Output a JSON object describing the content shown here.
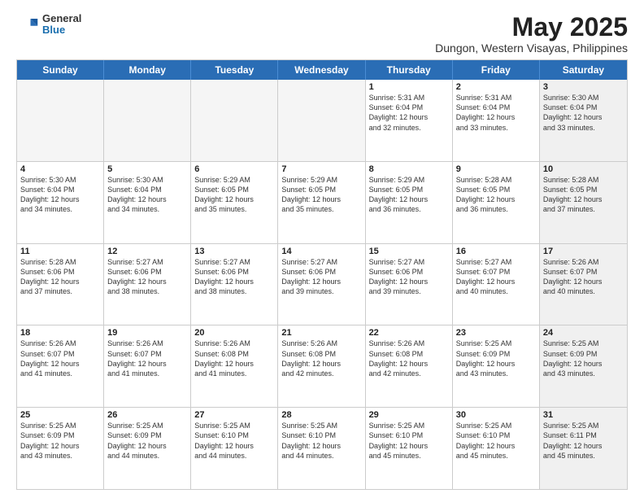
{
  "logo": {
    "general": "General",
    "blue": "Blue"
  },
  "title": "May 2025",
  "subtitle": "Dungon, Western Visayas, Philippines",
  "headers": [
    "Sunday",
    "Monday",
    "Tuesday",
    "Wednesday",
    "Thursday",
    "Friday",
    "Saturday"
  ],
  "rows": [
    [
      {
        "day": "",
        "info": "",
        "empty": true
      },
      {
        "day": "",
        "info": "",
        "empty": true
      },
      {
        "day": "",
        "info": "",
        "empty": true
      },
      {
        "day": "",
        "info": "",
        "empty": true
      },
      {
        "day": "1",
        "info": "Sunrise: 5:31 AM\nSunset: 6:04 PM\nDaylight: 12 hours\nand 32 minutes.",
        "empty": false
      },
      {
        "day": "2",
        "info": "Sunrise: 5:31 AM\nSunset: 6:04 PM\nDaylight: 12 hours\nand 33 minutes.",
        "empty": false
      },
      {
        "day": "3",
        "info": "Sunrise: 5:30 AM\nSunset: 6:04 PM\nDaylight: 12 hours\nand 33 minutes.",
        "empty": false,
        "shaded": true
      }
    ],
    [
      {
        "day": "4",
        "info": "Sunrise: 5:30 AM\nSunset: 6:04 PM\nDaylight: 12 hours\nand 34 minutes.",
        "empty": false
      },
      {
        "day": "5",
        "info": "Sunrise: 5:30 AM\nSunset: 6:04 PM\nDaylight: 12 hours\nand 34 minutes.",
        "empty": false
      },
      {
        "day": "6",
        "info": "Sunrise: 5:29 AM\nSunset: 6:05 PM\nDaylight: 12 hours\nand 35 minutes.",
        "empty": false
      },
      {
        "day": "7",
        "info": "Sunrise: 5:29 AM\nSunset: 6:05 PM\nDaylight: 12 hours\nand 35 minutes.",
        "empty": false
      },
      {
        "day": "8",
        "info": "Sunrise: 5:29 AM\nSunset: 6:05 PM\nDaylight: 12 hours\nand 36 minutes.",
        "empty": false
      },
      {
        "day": "9",
        "info": "Sunrise: 5:28 AM\nSunset: 6:05 PM\nDaylight: 12 hours\nand 36 minutes.",
        "empty": false
      },
      {
        "day": "10",
        "info": "Sunrise: 5:28 AM\nSunset: 6:05 PM\nDaylight: 12 hours\nand 37 minutes.",
        "empty": false,
        "shaded": true
      }
    ],
    [
      {
        "day": "11",
        "info": "Sunrise: 5:28 AM\nSunset: 6:06 PM\nDaylight: 12 hours\nand 37 minutes.",
        "empty": false
      },
      {
        "day": "12",
        "info": "Sunrise: 5:27 AM\nSunset: 6:06 PM\nDaylight: 12 hours\nand 38 minutes.",
        "empty": false
      },
      {
        "day": "13",
        "info": "Sunrise: 5:27 AM\nSunset: 6:06 PM\nDaylight: 12 hours\nand 38 minutes.",
        "empty": false
      },
      {
        "day": "14",
        "info": "Sunrise: 5:27 AM\nSunset: 6:06 PM\nDaylight: 12 hours\nand 39 minutes.",
        "empty": false
      },
      {
        "day": "15",
        "info": "Sunrise: 5:27 AM\nSunset: 6:06 PM\nDaylight: 12 hours\nand 39 minutes.",
        "empty": false
      },
      {
        "day": "16",
        "info": "Sunrise: 5:27 AM\nSunset: 6:07 PM\nDaylight: 12 hours\nand 40 minutes.",
        "empty": false
      },
      {
        "day": "17",
        "info": "Sunrise: 5:26 AM\nSunset: 6:07 PM\nDaylight: 12 hours\nand 40 minutes.",
        "empty": false,
        "shaded": true
      }
    ],
    [
      {
        "day": "18",
        "info": "Sunrise: 5:26 AM\nSunset: 6:07 PM\nDaylight: 12 hours\nand 41 minutes.",
        "empty": false
      },
      {
        "day": "19",
        "info": "Sunrise: 5:26 AM\nSunset: 6:07 PM\nDaylight: 12 hours\nand 41 minutes.",
        "empty": false
      },
      {
        "day": "20",
        "info": "Sunrise: 5:26 AM\nSunset: 6:08 PM\nDaylight: 12 hours\nand 41 minutes.",
        "empty": false
      },
      {
        "day": "21",
        "info": "Sunrise: 5:26 AM\nSunset: 6:08 PM\nDaylight: 12 hours\nand 42 minutes.",
        "empty": false
      },
      {
        "day": "22",
        "info": "Sunrise: 5:26 AM\nSunset: 6:08 PM\nDaylight: 12 hours\nand 42 minutes.",
        "empty": false
      },
      {
        "day": "23",
        "info": "Sunrise: 5:25 AM\nSunset: 6:09 PM\nDaylight: 12 hours\nand 43 minutes.",
        "empty": false
      },
      {
        "day": "24",
        "info": "Sunrise: 5:25 AM\nSunset: 6:09 PM\nDaylight: 12 hours\nand 43 minutes.",
        "empty": false,
        "shaded": true
      }
    ],
    [
      {
        "day": "25",
        "info": "Sunrise: 5:25 AM\nSunset: 6:09 PM\nDaylight: 12 hours\nand 43 minutes.",
        "empty": false
      },
      {
        "day": "26",
        "info": "Sunrise: 5:25 AM\nSunset: 6:09 PM\nDaylight: 12 hours\nand 44 minutes.",
        "empty": false
      },
      {
        "day": "27",
        "info": "Sunrise: 5:25 AM\nSunset: 6:10 PM\nDaylight: 12 hours\nand 44 minutes.",
        "empty": false
      },
      {
        "day": "28",
        "info": "Sunrise: 5:25 AM\nSunset: 6:10 PM\nDaylight: 12 hours\nand 44 minutes.",
        "empty": false
      },
      {
        "day": "29",
        "info": "Sunrise: 5:25 AM\nSunset: 6:10 PM\nDaylight: 12 hours\nand 45 minutes.",
        "empty": false
      },
      {
        "day": "30",
        "info": "Sunrise: 5:25 AM\nSunset: 6:10 PM\nDaylight: 12 hours\nand 45 minutes.",
        "empty": false
      },
      {
        "day": "31",
        "info": "Sunrise: 5:25 AM\nSunset: 6:11 PM\nDaylight: 12 hours\nand 45 minutes.",
        "empty": false,
        "shaded": true
      }
    ]
  ]
}
